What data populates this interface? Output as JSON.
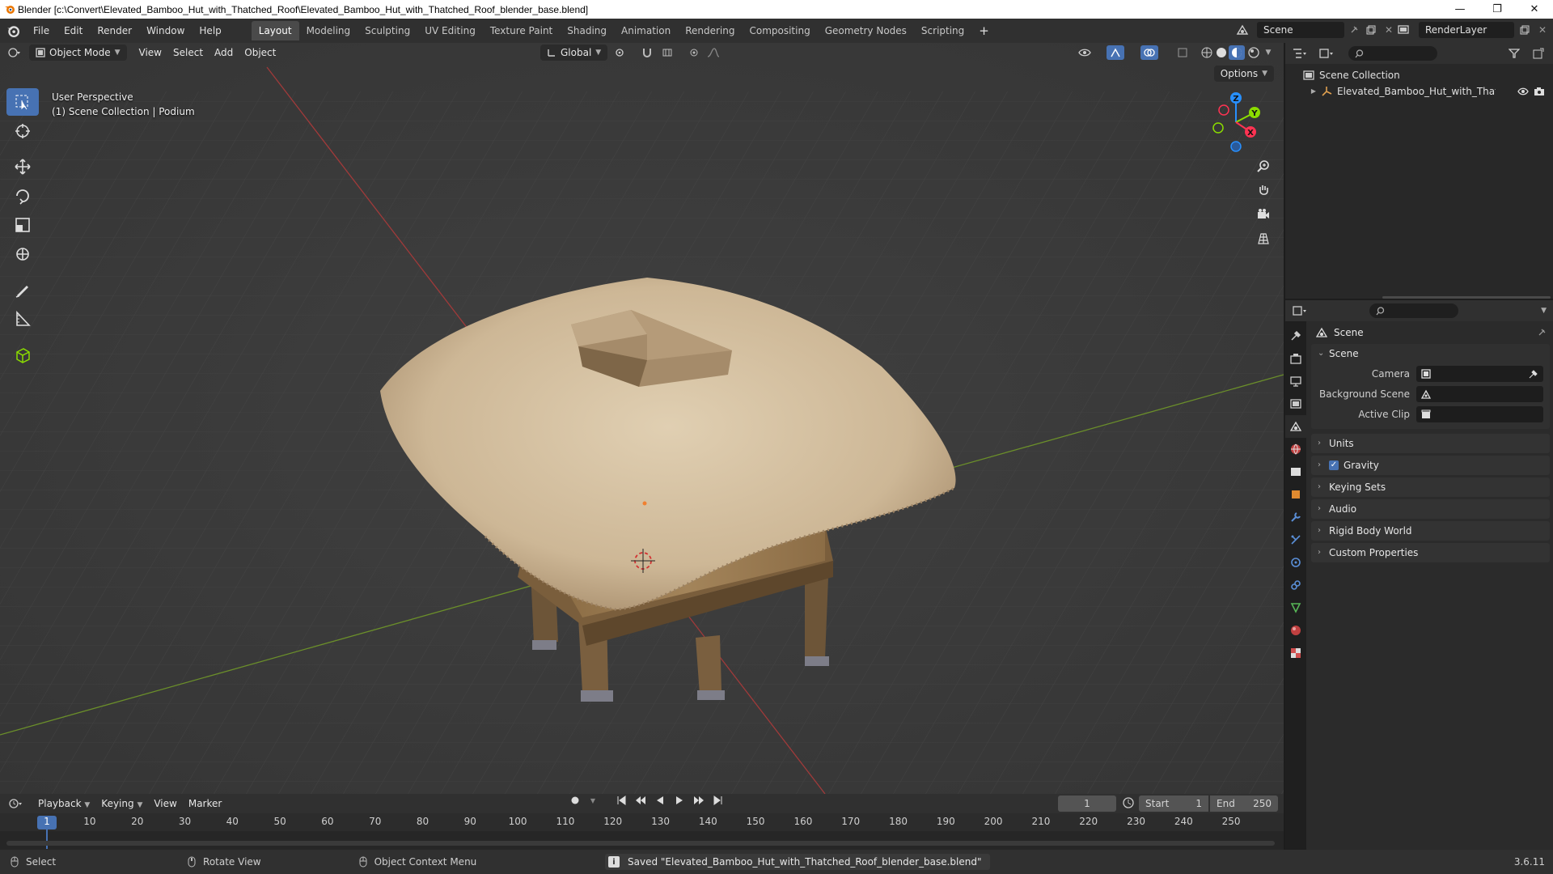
{
  "window": {
    "title": "Blender [c:\\Convert\\Elevated_Bamboo_Hut_with_Thatched_Roof\\Elevated_Bamboo_Hut_with_Thatched_Roof_blender_base.blend]",
    "minimize": "—",
    "maximize": "❐",
    "close": "✕"
  },
  "menu": {
    "items": [
      "File",
      "Edit",
      "Render",
      "Window",
      "Help"
    ]
  },
  "workspaces": {
    "tabs": [
      "Layout",
      "Modeling",
      "Sculpting",
      "UV Editing",
      "Texture Paint",
      "Shading",
      "Animation",
      "Rendering",
      "Compositing",
      "Geometry Nodes",
      "Scripting"
    ],
    "active": "Layout",
    "add": "+"
  },
  "scene_selector": {
    "value": "Scene"
  },
  "view_layer_selector": {
    "value": "RenderLayer"
  },
  "viewport": {
    "mode": "Object Mode",
    "menus": [
      "View",
      "Select",
      "Add",
      "Object"
    ],
    "transform_orientation": "Global",
    "options_label": "Options",
    "info_line1": "User Perspective",
    "info_line2": "(1) Scene Collection | Podium",
    "gizmo_axes": {
      "x": "X",
      "y": "Y",
      "z": "Z"
    }
  },
  "outliner": {
    "root": "Scene Collection",
    "items": [
      {
        "name": "Elevated_Bamboo_Hut_with_Thatched_I"
      }
    ]
  },
  "properties": {
    "context_title": "Scene",
    "scene_panel": {
      "title": "Scene",
      "camera_label": "Camera",
      "background_label": "Background Scene",
      "active_clip_label": "Active Clip"
    },
    "panels": [
      {
        "title": "Units",
        "checkbox": false
      },
      {
        "title": "Gravity",
        "checkbox": true
      },
      {
        "title": "Keying Sets",
        "checkbox": false
      },
      {
        "title": "Audio",
        "checkbox": false
      },
      {
        "title": "Rigid Body World",
        "checkbox": false
      },
      {
        "title": "Custom Properties",
        "checkbox": false
      }
    ]
  },
  "timeline": {
    "menus": [
      "Playback",
      "Keying",
      "View",
      "Marker"
    ],
    "current_frame": "1",
    "start_label": "Start",
    "start_value": "1",
    "end_label": "End",
    "end_value": "250",
    "ruler": [
      "1",
      "10",
      "20",
      "30",
      "40",
      "50",
      "60",
      "70",
      "80",
      "90",
      "100",
      "110",
      "120",
      "130",
      "140",
      "150",
      "160",
      "170",
      "180",
      "190",
      "200",
      "210",
      "220",
      "230",
      "240",
      "250"
    ]
  },
  "status": {
    "select": "Select",
    "rotate": "Rotate View",
    "context": "Object Context Menu",
    "message": "Saved \"Elevated_Bamboo_Hut_with_Thatched_Roof_blender_base.blend\"",
    "version": "3.6.11"
  },
  "colors": {
    "accent": "#4772b3",
    "x_axis": "#ff3352",
    "y_axis": "#8bdc00",
    "z_axis": "#2890ff",
    "playhead": "#4772b3"
  }
}
